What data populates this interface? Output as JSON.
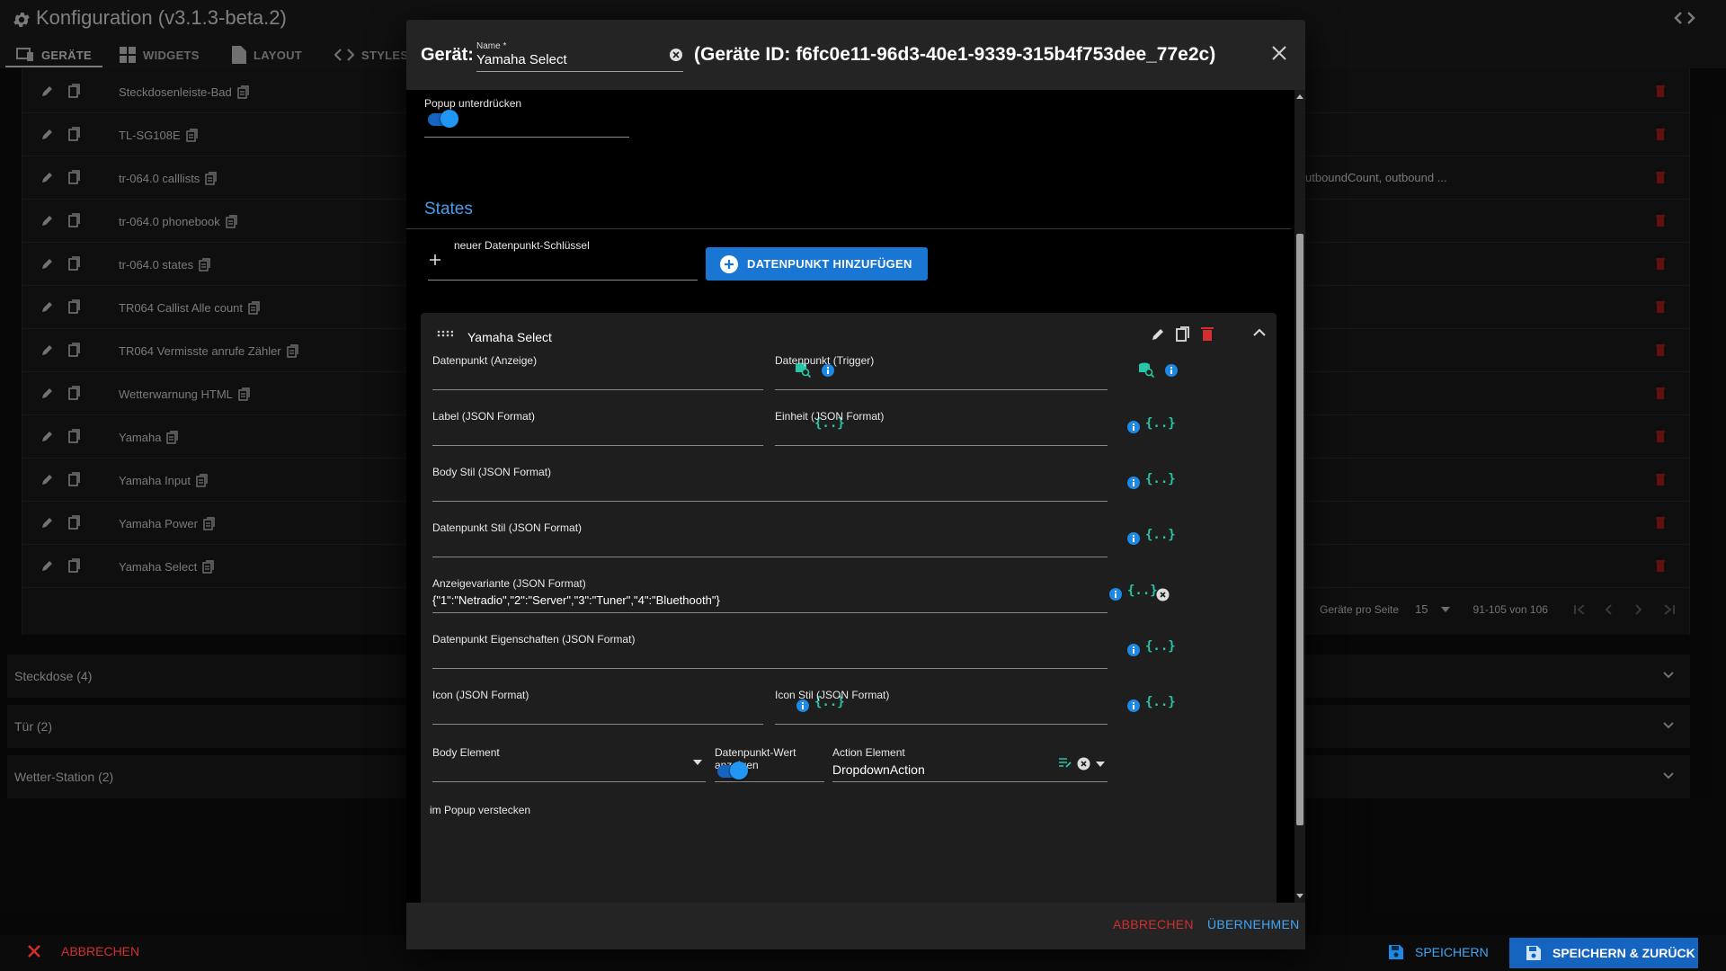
{
  "app": {
    "title": "Konfiguration (v3.1.3-beta.2)"
  },
  "tabs": [
    {
      "label": "GERÄTE",
      "icon": "devices-icon",
      "active": true
    },
    {
      "label": "WIDGETS",
      "icon": "widgets-icon"
    },
    {
      "label": "LAYOUT",
      "icon": "file-icon"
    },
    {
      "label": "STYLES",
      "icon": "code-icon"
    }
  ],
  "devices": [
    "Steckdosenleiste-Bad",
    "TL-SG108E",
    "tr-064.0 calllists",
    "tr-064.0 phonebook",
    "tr-064.0 states",
    "TR064 Callist Alle count",
    "TR064 Vermisste anrufe Zähler",
    "Wetterwarnung HTML",
    "Yamaha",
    "Yamaha Input",
    "Yamaha Power",
    "Yamaha Select"
  ],
  "extra_cell": "utboundCount, outbound ...",
  "pager": {
    "per_page_label": "Geräte pro Seite",
    "per_page": "15",
    "range": "91-105 von 106"
  },
  "groups": [
    {
      "label": "Steckdose (4)"
    },
    {
      "label": "Tür (2)"
    },
    {
      "label": "Wetter-Station (2)"
    }
  ],
  "footer": {
    "cancel": "ABBRECHEN",
    "save": "SPEICHERN",
    "save_back": "SPEICHERN & ZURÜCK"
  },
  "dialog": {
    "prefix": "Gerät:",
    "name_label": "Name *",
    "name_value": "Yamaha Select",
    "device_id": "(Geräte ID: f6fc0e11-96d3-40e1-9339-315b4f753dee_77e2c)",
    "popup_label": "Popup unterdrücken",
    "popup_on": true,
    "states_header": "States",
    "new_key_label": "neuer Datenpunkt-Schlüssel",
    "add_button": "DATENPUNKT HINZUFÜGEN",
    "panel": {
      "title": "Yamaha Select",
      "fields": {
        "dp_display": "Datenpunkt (Anzeige)",
        "dp_trigger": "Datenpunkt (Trigger)",
        "label_json": "Label (JSON Format)",
        "unit_json": "Einheit (JSON Format)",
        "body_style": "Body Stil (JSON Format)",
        "dp_style": "Datenpunkt Stil (JSON Format)",
        "variant_label": "Anzeigevariante (JSON Format)",
        "variant_value": "{\"1\":\"Netradio\",\"2\":\"Server\",\"3\":\"Tuner\",\"4\":\"Bluethooth\"}",
        "dp_props": "Datenpunkt Eigenschaften (JSON Format)",
        "icon_json": "Icon (JSON Format)",
        "icon_style": "Icon Stil (JSON Format)",
        "body_element": "Body Element",
        "show_value": "Datenpunkt-Wert anzeigen",
        "action_element": "Action Element",
        "action_value": "DropdownAction",
        "hide_popup": "im Popup verstecken"
      },
      "json_glyph": "{..}"
    },
    "cancel": "ABBRECHEN",
    "apply": "ÜBERNEHMEN"
  },
  "colors": {
    "accent": "#1976d2",
    "danger": "#d32f2f",
    "json": "#26c6a6",
    "states": "#4a9be8"
  }
}
